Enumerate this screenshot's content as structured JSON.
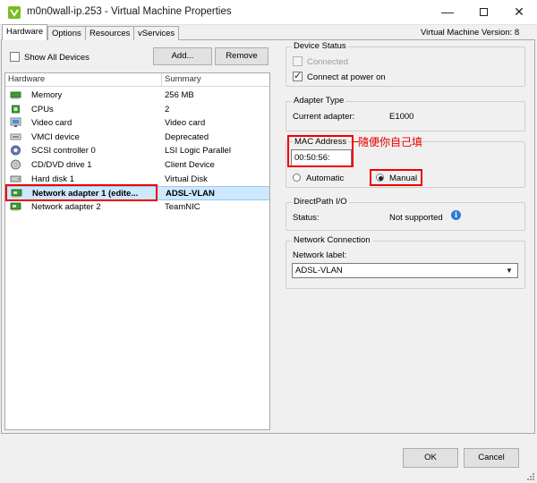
{
  "window": {
    "title": "m0n0wall-ip.253 - Virtual Machine Properties",
    "controls": {
      "minimize": "—",
      "close": "✕"
    }
  },
  "tabs": [
    {
      "label": "Hardware",
      "active": true
    },
    {
      "label": "Options",
      "active": false
    },
    {
      "label": "Resources",
      "active": false
    },
    {
      "label": "vServices",
      "active": false
    }
  ],
  "vm_version": "Virtual Machine Version: 8",
  "left": {
    "show_all_label": "Show All Devices",
    "show_all_checked": false,
    "add_label": "Add...",
    "remove_label": "Remove",
    "columns": [
      "Hardware",
      "Summary"
    ],
    "rows": [
      {
        "icon": "memory-icon",
        "name": "Memory",
        "summary": "256 MB",
        "selected": false
      },
      {
        "icon": "cpu-icon",
        "name": "CPUs",
        "summary": "2",
        "selected": false
      },
      {
        "icon": "video-card-icon",
        "name": "Video card",
        "summary": "Video card",
        "selected": false
      },
      {
        "icon": "vmci-device-icon",
        "name": "VMCI device",
        "summary": "Deprecated",
        "selected": false
      },
      {
        "icon": "scsi-controller-icon",
        "name": "SCSI controller 0",
        "summary": "LSI Logic Parallel",
        "selected": false
      },
      {
        "icon": "cd-dvd-icon",
        "name": "CD/DVD drive 1",
        "summary": "Client Device",
        "selected": false
      },
      {
        "icon": "hard-disk-icon",
        "name": "Hard disk 1",
        "summary": "Virtual Disk",
        "selected": false
      },
      {
        "icon": "network-adapter-icon",
        "name": "Network adapter 1 (edite...",
        "summary": "ADSL-VLAN",
        "selected": true
      },
      {
        "icon": "network-adapter-icon",
        "name": "Network adapter 2",
        "summary": "TeamNIC",
        "selected": false
      }
    ]
  },
  "right": {
    "device_status": {
      "title": "Device Status",
      "connected_label": "Connected",
      "connected_checked": false,
      "power_on_label": "Connect at power on",
      "power_on_checked": true
    },
    "adapter_type": {
      "title": "Adapter Type",
      "current_label": "Current adapter:",
      "current_value": "E1000"
    },
    "mac": {
      "title": "MAC Address",
      "value": "00:50:56:",
      "annotation": "隨便你自己填",
      "automatic_label": "Automatic",
      "manual_label": "Manual",
      "selected": "manual"
    },
    "directpath": {
      "title": "DirectPath I/O",
      "status_label": "Status:",
      "status_value": "Not supported"
    },
    "network_connection": {
      "title": "Network Connection",
      "label": "Network label:",
      "value": "ADSL-VLAN"
    }
  },
  "footer": {
    "ok_label": "OK",
    "cancel_label": "Cancel"
  },
  "colors": {
    "annotation_red": "#ee0000",
    "selection": "#cde8ff",
    "vmware_icon": "#78be20"
  }
}
